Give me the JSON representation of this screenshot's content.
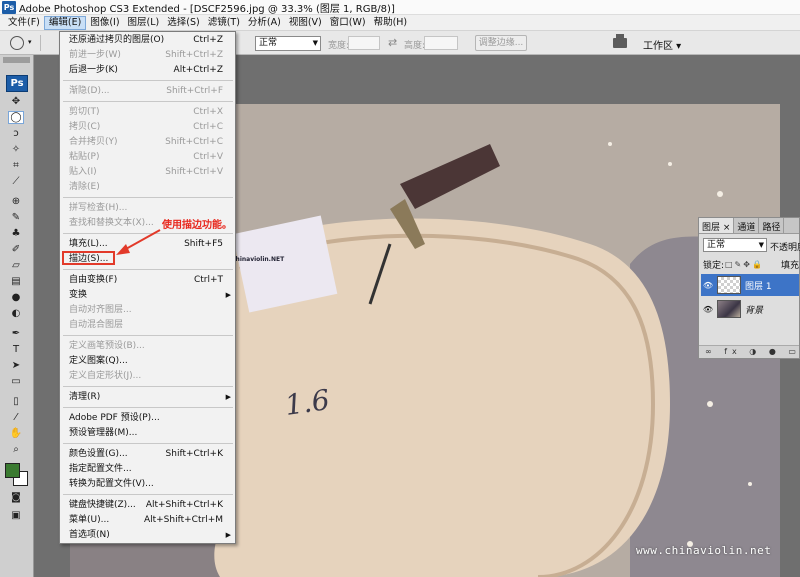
{
  "app": {
    "title": "Adobe Photoshop CS3 Extended - [DSCF2596.jpg @ 33.3% (图层 1, RGB/8)]",
    "mini_logo": "Ps"
  },
  "menubar": {
    "items": [
      "文件(F)",
      "编辑(E)",
      "图像(I)",
      "图层(L)",
      "选择(S)",
      "滤镜(T)",
      "分析(A)",
      "视图(V)",
      "窗口(W)",
      "帮助(H)"
    ],
    "active_index": 1
  },
  "options_bar": {
    "style_value": "正常",
    "width_label": "宽度:",
    "height_label": "高度:",
    "refine_edge_label": "调整边缘...",
    "workspace_label": "工作区 ▾"
  },
  "toolbox": {
    "logo": "Ps",
    "fg_color": "#3a7a30",
    "bg_color": "#ffffff"
  },
  "edit_menu": {
    "items": [
      {
        "label": "还原通过拷贝的图层(O)",
        "shortcut": "Ctrl+Z",
        "disabled": false
      },
      {
        "label": "前进一步(W)",
        "shortcut": "Shift+Ctrl+Z",
        "disabled": true
      },
      {
        "label": "后退一步(K)",
        "shortcut": "Alt+Ctrl+Z",
        "disabled": false
      },
      {
        "label": "渐隐(D)...",
        "shortcut": "Shift+Ctrl+F",
        "disabled": true
      },
      {
        "label": "剪切(T)",
        "shortcut": "Ctrl+X",
        "disabled": true
      },
      {
        "label": "拷贝(C)",
        "shortcut": "Ctrl+C",
        "disabled": true
      },
      {
        "label": "合并拷贝(Y)",
        "shortcut": "Shift+Ctrl+C",
        "disabled": true
      },
      {
        "label": "粘贴(P)",
        "shortcut": "Ctrl+V",
        "disabled": true
      },
      {
        "label": "贴入(I)",
        "shortcut": "Shift+Ctrl+V",
        "disabled": true
      },
      {
        "label": "清除(E)",
        "shortcut": "",
        "disabled": true
      },
      {
        "label": "拼写检查(H)...",
        "shortcut": "",
        "disabled": true
      },
      {
        "label": "查找和替换文本(X)...",
        "shortcut": "",
        "disabled": true
      },
      {
        "label": "填充(L)...",
        "shortcut": "Shift+F5",
        "disabled": false
      },
      {
        "label": "描边(S)...",
        "shortcut": "",
        "disabled": false
      },
      {
        "label": "自由变换(F)",
        "shortcut": "Ctrl+T",
        "disabled": false
      },
      {
        "label": "变换",
        "shortcut": "",
        "disabled": false,
        "submenu": true
      },
      {
        "label": "自动对齐图层...",
        "shortcut": "",
        "disabled": true
      },
      {
        "label": "自动混合图层",
        "shortcut": "",
        "disabled": true
      },
      {
        "label": "定义画笔预设(B)...",
        "shortcut": "",
        "disabled": true
      },
      {
        "label": "定义图案(Q)...",
        "shortcut": "",
        "disabled": false
      },
      {
        "label": "定义自定形状(J)...",
        "shortcut": "",
        "disabled": true
      },
      {
        "label": "清理(R)",
        "shortcut": "",
        "disabled": false,
        "submenu": true
      },
      {
        "label": "Adobe PDF 预设(P)...",
        "shortcut": "",
        "disabled": false
      },
      {
        "label": "预设管理器(M)...",
        "shortcut": "",
        "disabled": false
      },
      {
        "label": "颜色设置(G)...",
        "shortcut": "Shift+Ctrl+K",
        "disabled": false
      },
      {
        "label": "指定配置文件...",
        "shortcut": "",
        "disabled": false
      },
      {
        "label": "转换为配置文件(V)...",
        "shortcut": "",
        "disabled": false
      },
      {
        "label": "键盘快捷键(Z)...",
        "shortcut": "Alt+Shift+Ctrl+K",
        "disabled": false
      },
      {
        "label": "菜单(U)...",
        "shortcut": "Alt+Shift+Ctrl+M",
        "disabled": false
      },
      {
        "label": "首选项(N)",
        "shortcut": "",
        "disabled": false,
        "submenu": true
      }
    ],
    "highlight_label": "描边(S)...",
    "highlight_color": "#e23a2a"
  },
  "annotation": {
    "text": "使用描边功能。",
    "color": "#e8271d"
  },
  "layers_panel": {
    "tabs": [
      "图层",
      "通道",
      "路径"
    ],
    "blend_mode": "正常",
    "opacity_label": "不透明度",
    "lock_label": "锁定:",
    "fill_label": "填充",
    "layers": [
      {
        "name": "图层 1",
        "selected": true
      },
      {
        "name": "背景",
        "selected": false
      }
    ]
  },
  "canvas": {
    "watermark": "www.chinaviolin.net",
    "card_text": "chinaviolin.NET",
    "pencil_mark": "1.6"
  }
}
